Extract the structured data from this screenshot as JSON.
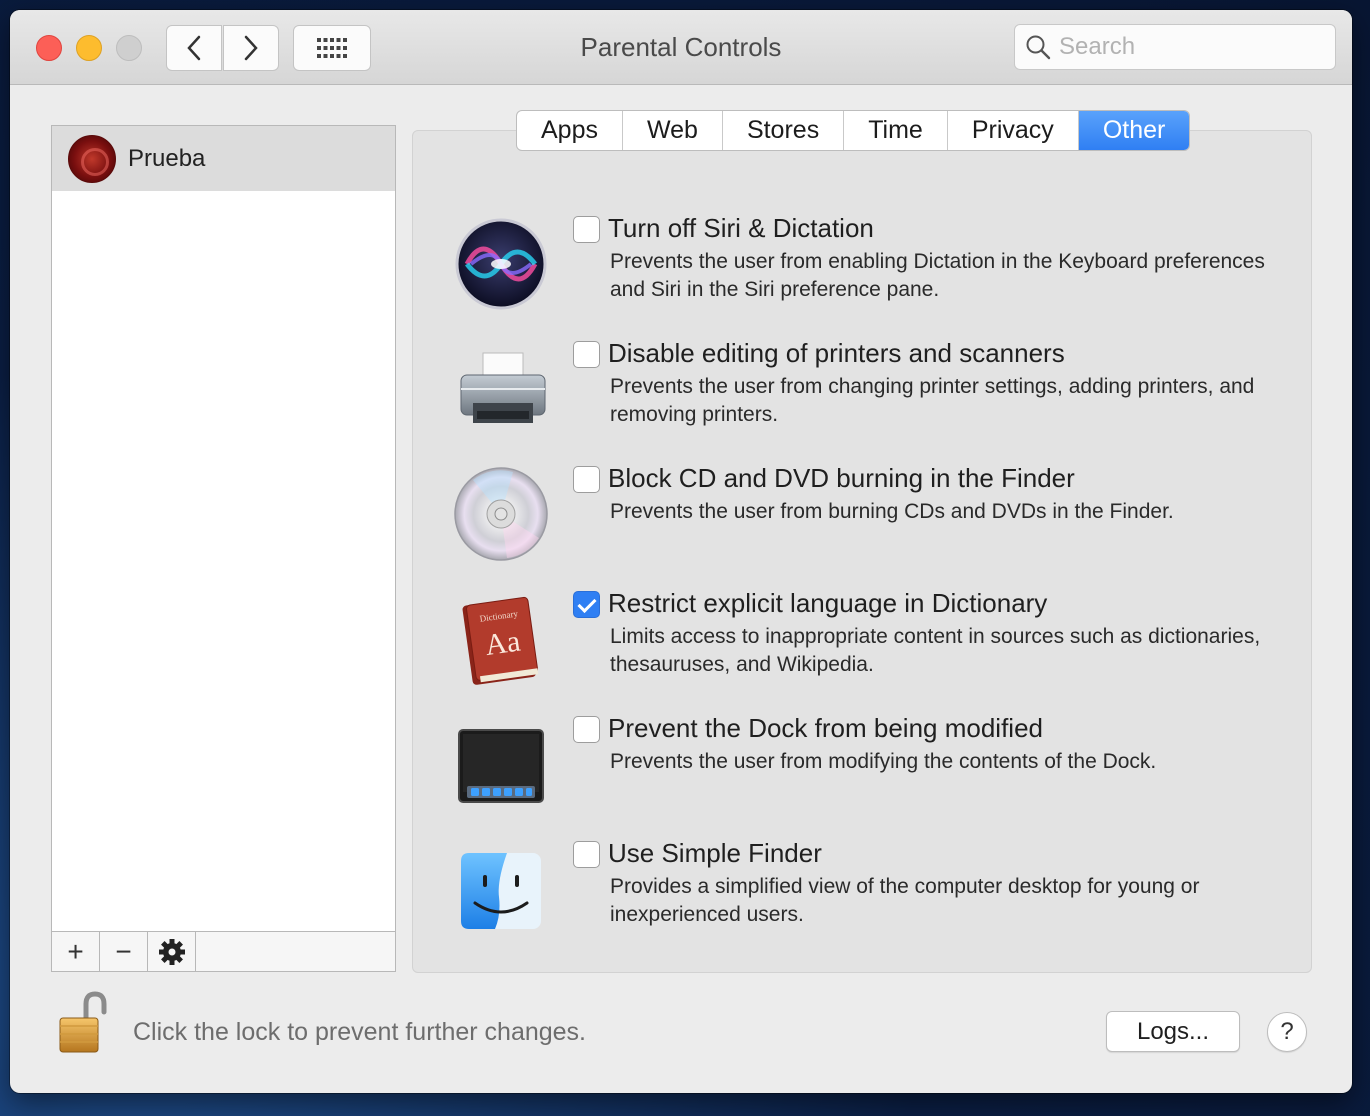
{
  "window": {
    "title": "Parental Controls"
  },
  "search": {
    "placeholder": "Search"
  },
  "users": [
    {
      "name": "Prueba"
    }
  ],
  "list_toolbar": {
    "add": "+",
    "remove": "−"
  },
  "tabs": [
    {
      "label": "Apps",
      "active": false
    },
    {
      "label": "Web",
      "active": false
    },
    {
      "label": "Stores",
      "active": false
    },
    {
      "label": "Time",
      "active": false
    },
    {
      "label": "Privacy",
      "active": false
    },
    {
      "label": "Other",
      "active": true
    }
  ],
  "options": [
    {
      "icon": "siri-icon",
      "title": "Turn off Siri & Dictation",
      "desc": "Prevents the user from enabling Dictation in the Keyboard preferences and Siri in the Siri preference pane.",
      "checked": false
    },
    {
      "icon": "printer-icon",
      "title": "Disable editing of printers and scanners",
      "desc": "Prevents the user from changing printer settings, adding printers, and removing printers.",
      "checked": false
    },
    {
      "icon": "cd-icon",
      "title": "Block CD and DVD burning in the Finder",
      "desc": "Prevents the user from burning CDs and DVDs in the Finder.",
      "checked": false
    },
    {
      "icon": "dictionary-icon",
      "title": "Restrict explicit language in Dictionary",
      "desc": "Limits access to inappropriate content in sources such as dictionaries, thesauruses, and Wikipedia.",
      "checked": true
    },
    {
      "icon": "dock-icon",
      "title": "Prevent the Dock from being modified",
      "desc": "Prevents the user from modifying the contents of the Dock.",
      "checked": false
    },
    {
      "icon": "finder-icon",
      "title": "Use Simple Finder",
      "desc": "Provides a simplified view of the computer desktop for young or inexperienced users.",
      "checked": false
    }
  ],
  "dictionary_icon": {
    "small": "Dictionary",
    "large": "Aa"
  },
  "footer": {
    "lock_text": "Click the lock to prevent further changes.",
    "logs_label": "Logs...",
    "help_label": "?"
  },
  "colors": {
    "accent": "#2f7ff3",
    "close": "#fc5f57",
    "minimize": "#fdbc2e"
  }
}
